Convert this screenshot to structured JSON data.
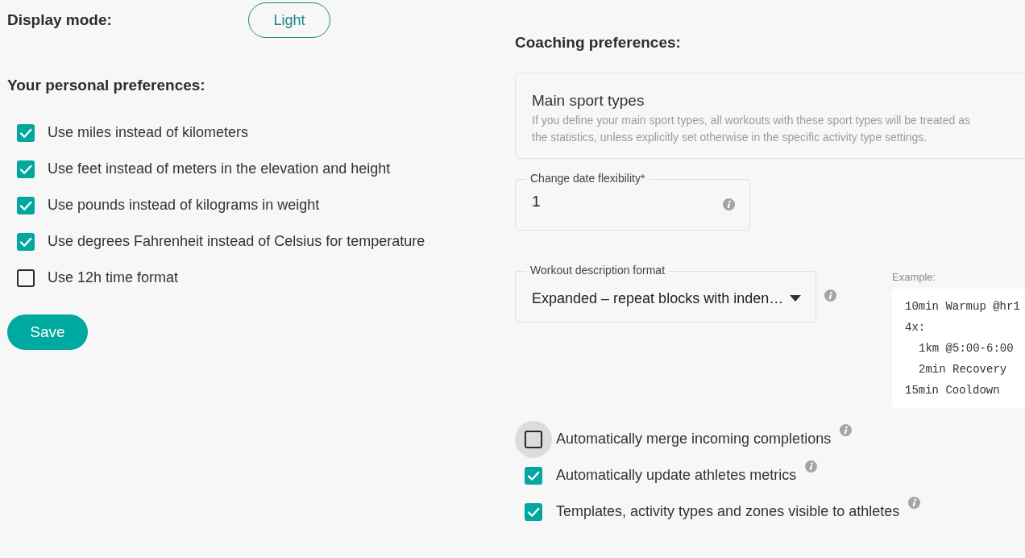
{
  "display_mode": {
    "label": "Display mode:",
    "button": "Light"
  },
  "personal_preferences": {
    "title": "Your personal preferences:",
    "options": [
      {
        "label": "Use miles instead of kilometers",
        "checked": true
      },
      {
        "label": "Use feet instead of meters in the elevation and height",
        "checked": true
      },
      {
        "label": "Use pounds instead of kilograms in weight",
        "checked": true
      },
      {
        "label": "Use degrees Fahrenheit instead of Celsius for temperature",
        "checked": true
      },
      {
        "label": "Use 12h time format",
        "checked": false
      }
    ],
    "save_button": "Save"
  },
  "coaching_preferences": {
    "title": "Coaching preferences:",
    "main_sport_types": {
      "title": "Main sport types",
      "description_lines": [
        "If you define your main sport types, all workouts with these sport types will be treated as",
        "the statistics, unless explicitly set otherwise in the specific activity type settings."
      ]
    },
    "change_date_flexibility": {
      "label": "Change date flexibility*",
      "value": "1"
    },
    "workout_description_format": {
      "label": "Workout description format",
      "value": "Expanded – repeat blocks with inden…"
    },
    "example": {
      "label": "Example:",
      "lines": [
        {
          "text": "10min Warmup @hr1"
        },
        {
          "text": "4x:",
          "children": [
            {
              "text": "1km @5:00-6:00"
            },
            {
              "text": "2min Recovery"
            }
          ]
        },
        {
          "text": "15min Cooldown"
        }
      ]
    },
    "options": [
      {
        "label": "Automatically merge incoming completions",
        "checked": false,
        "focused": true
      },
      {
        "label": "Automatically update athletes metrics",
        "checked": true,
        "focused": false
      },
      {
        "label": "Templates, activity types and zones visible to athletes",
        "checked": true,
        "focused": false
      }
    ]
  }
}
